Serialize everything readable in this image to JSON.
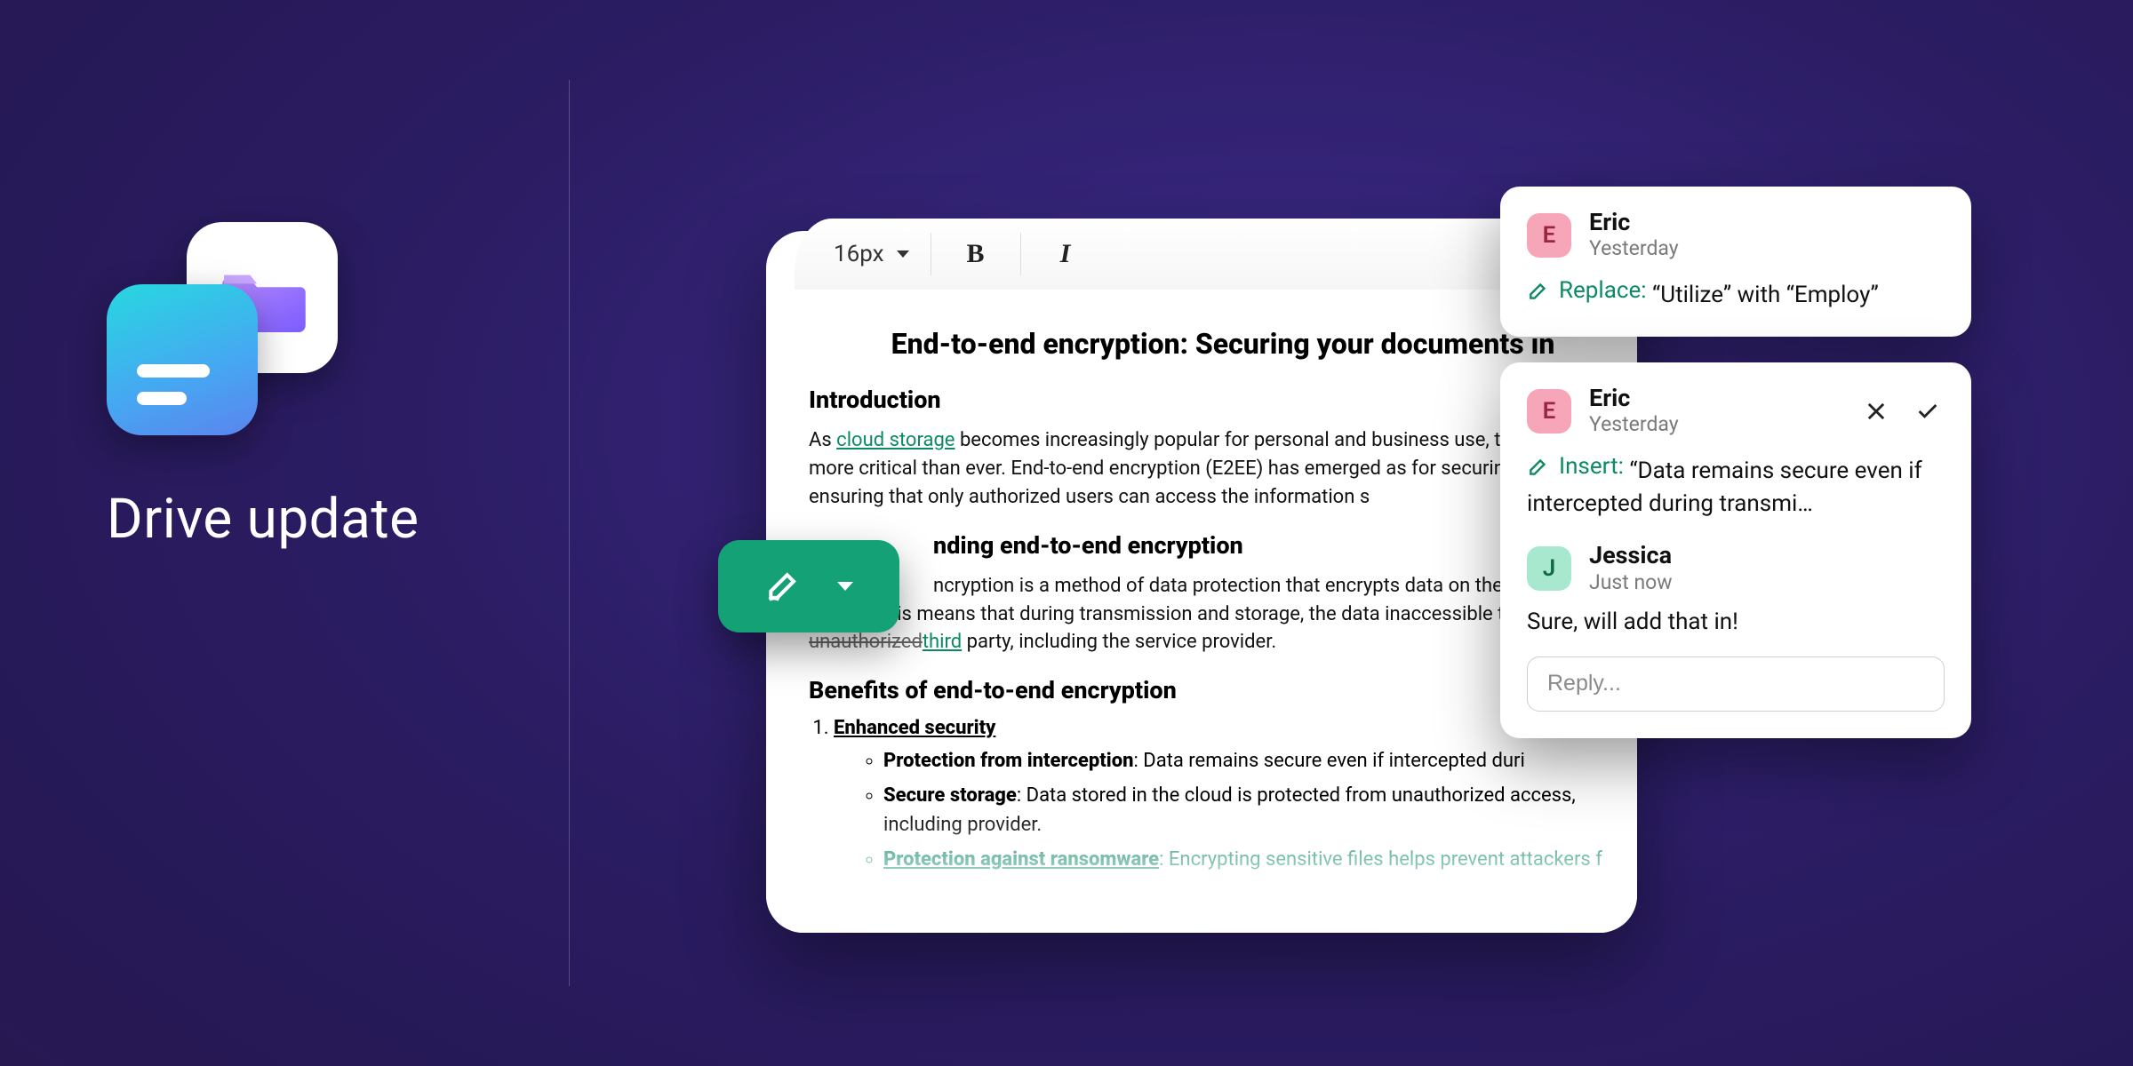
{
  "brand": {
    "title": "Drive update"
  },
  "toolbar": {
    "font_size": "16px",
    "bold_label": "B",
    "italic_label": "I"
  },
  "document": {
    "title": "End-to-end encryption: Securing your documents in",
    "sections": {
      "intro": {
        "heading": "Introduction",
        "text_pre": "As ",
        "link": "cloud storage",
        "text_post": " becomes increasingly popular for personal and business use, the measures is more critical than ever. End-to-end encryption (E2EE) has emerged as for securing data, ensuring that only authorized users can access the information s"
      },
      "understanding": {
        "heading": "nding end-to-end encryption",
        "text_pre": "ncryption is a method of data protection that encrypts data on the send ent's device. This means that during transmission and storage, the data inaccessible to any ",
        "strike": "unauthorized",
        "insert": "third",
        "text_post": " party, including the service provider."
      },
      "benefits": {
        "heading": "Benefits of end-to-end encryption",
        "item1_title": "Enhanced security",
        "sub": {
          "a_label": "Protection from interception",
          "a_text": ": Data remains secure even if intercepted duri",
          "b_label": "Secure storage",
          "b_text": ": Data stored in the cloud is protected from unauthorized access, including provider.",
          "c_label": "Protection against ransomware",
          "c_text": ": Encrypting sensitive files helps prevent attackers f"
        }
      }
    }
  },
  "comments": {
    "a": {
      "author": "Eric",
      "initial": "E",
      "timestamp": "Yesterday",
      "action": "Replace:",
      "content": "“Utilize” with “Employ”"
    },
    "b": {
      "author": "Eric",
      "initial": "E",
      "timestamp": "Yesterday",
      "action": "Insert:",
      "content": "“Data remains secure even if intercepted during transmi…",
      "reply": {
        "author": "Jessica",
        "initial": "J",
        "timestamp": "Just now",
        "text": "Sure, will add that in!"
      },
      "reply_placeholder": "Reply..."
    }
  }
}
